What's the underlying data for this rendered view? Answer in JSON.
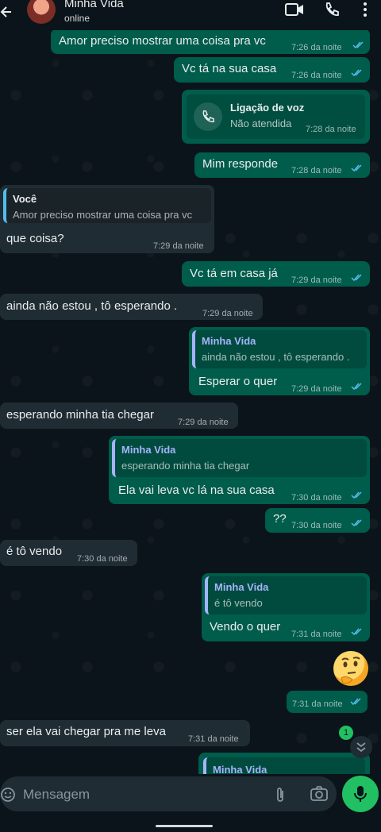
{
  "header": {
    "contact_name": "Minha Vida",
    "status": "online"
  },
  "messages": [
    {
      "text": "Amor preciso mostrar uma coisa pra vc",
      "time": "7:26 da noite"
    },
    {
      "text": "Vc tá na sua casa",
      "time": "7:26 da noite"
    },
    {
      "call_title": "Ligação de voz",
      "call_status": "Não atendida",
      "time": "7:28 da noite"
    },
    {
      "text": "Mim responde",
      "time": "7:28 da noite"
    },
    {
      "quote_name": "Você",
      "quote_text": "Amor preciso mostrar uma coisa pra vc",
      "text": "que coisa?",
      "time": "7:29 da noite"
    },
    {
      "text": "Vc tá em casa já",
      "time": "7:29 da noite"
    },
    {
      "text": "ainda não estou , tô esperando .",
      "time": "7:29 da noite"
    },
    {
      "quote_name": "Minha Vida",
      "quote_text": "ainda não estou , tô esperando .",
      "text": "Esperar o quer",
      "time": "7:29 da noite"
    },
    {
      "text": "esperando minha tia chegar",
      "time": "7:29 da noite"
    },
    {
      "quote_name": "Minha Vida",
      "quote_text": "esperando minha tia chegar",
      "text": "Ela vai leva vc lá na sua casa",
      "time": "7:30 da noite"
    },
    {
      "text": "??",
      "time": "7:30 da noite"
    },
    {
      "text": "é tô vendo",
      "time": "7:30 da noite"
    },
    {
      "quote_name": "Minha Vida",
      "quote_text": "é tô vendo",
      "text": "Vendo o quer",
      "time": "7:31 da noite"
    },
    {
      "text": "",
      "time": "7:31 da noite"
    },
    {
      "text": "ser ela vai chegar pra me leva",
      "time": "7:31 da noite"
    },
    {
      "quote_name": "Minha Vida"
    }
  ],
  "unread_count": "1",
  "composer": {
    "placeholder": "Mensagem"
  },
  "colors": {
    "outgoing_bubble": "#005c4b",
    "incoming_bubble": "#202c33",
    "background": "#0b141a",
    "accent_green": "#21c063",
    "read_ticks": "#53bdeb"
  }
}
